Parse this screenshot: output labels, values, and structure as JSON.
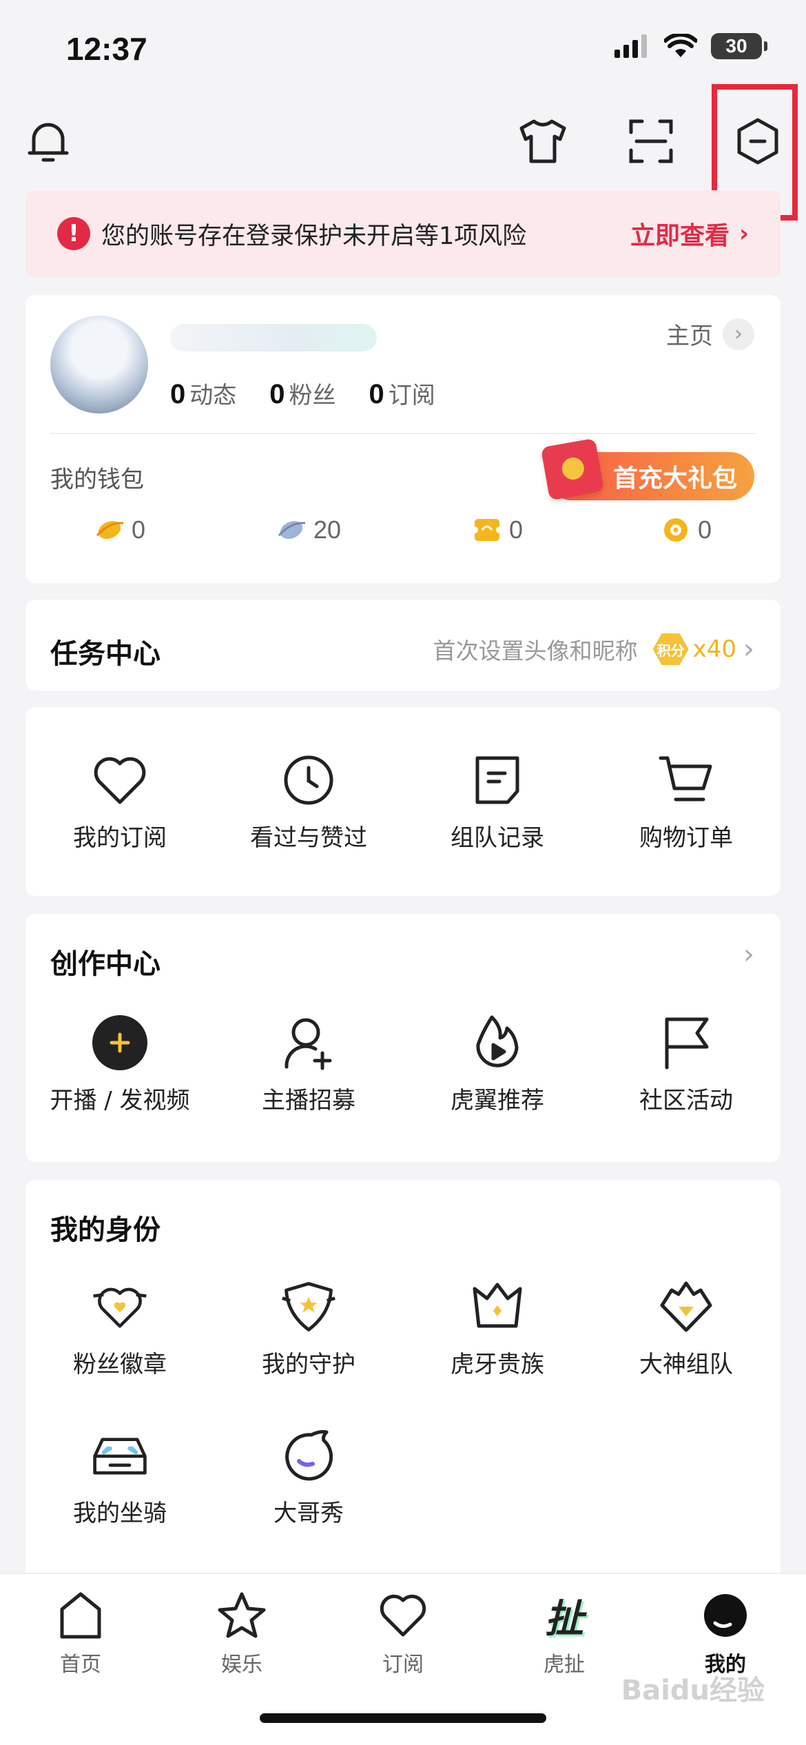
{
  "status": {
    "time": "12:37",
    "battery": "30"
  },
  "alert": {
    "text": "您的账号存在登录保护未开启等1项风险",
    "link": "立即查看"
  },
  "profile": {
    "homepage_label": "主页",
    "stats": [
      {
        "value": "0",
        "label": "动态"
      },
      {
        "value": "0",
        "label": "粉丝"
      },
      {
        "value": "0",
        "label": "订阅"
      }
    ],
    "wallet_label": "我的钱包",
    "gift_label": "首充大礼包",
    "wallet_items": [
      {
        "icon": "gold-bean-icon",
        "value": "0"
      },
      {
        "icon": "silver-bean-icon",
        "value": "20"
      },
      {
        "icon": "ticket-icon",
        "value": "0"
      },
      {
        "icon": "coin-icon",
        "value": "0"
      }
    ]
  },
  "task": {
    "title": "任务中心",
    "desc": "首次设置头像和昵称",
    "badge": "积分",
    "points": "x40"
  },
  "shortcuts": [
    {
      "icon": "heart-icon",
      "label": "我的订阅"
    },
    {
      "icon": "clock-icon",
      "label": "看过与赞过"
    },
    {
      "icon": "note-icon",
      "label": "组队记录"
    },
    {
      "icon": "cart-icon",
      "label": "购物订单"
    }
  ],
  "creator": {
    "title": "创作中心",
    "items": [
      {
        "icon": "plus-circle-icon",
        "label": "开播 / 发视频"
      },
      {
        "icon": "add-user-icon",
        "label": "主播招募"
      },
      {
        "icon": "flame-play-icon",
        "label": "虎翼推荐"
      },
      {
        "icon": "flag-icon",
        "label": "社区活动"
      }
    ]
  },
  "identity": {
    "title": "我的身份",
    "items": [
      {
        "icon": "fan-badge-icon",
        "label": "粉丝徽章"
      },
      {
        "icon": "guard-icon",
        "label": "我的守护"
      },
      {
        "icon": "crown-icon",
        "label": "虎牙贵族"
      },
      {
        "icon": "diamond-crown-icon",
        "label": "大神组队"
      },
      {
        "icon": "car-icon",
        "label": "我的坐骑"
      },
      {
        "icon": "bubble-icon",
        "label": "大哥秀"
      }
    ]
  },
  "tabbar": [
    {
      "icon": "home-icon",
      "label": "首页"
    },
    {
      "icon": "star-icon",
      "label": "娱乐"
    },
    {
      "icon": "heart-icon",
      "label": "订阅"
    },
    {
      "icon": "huche-icon",
      "label": "虎扯",
      "glyph": "扯"
    },
    {
      "icon": "me-icon",
      "label": "我的",
      "active": true
    }
  ],
  "watermark": "Baidu经验"
}
